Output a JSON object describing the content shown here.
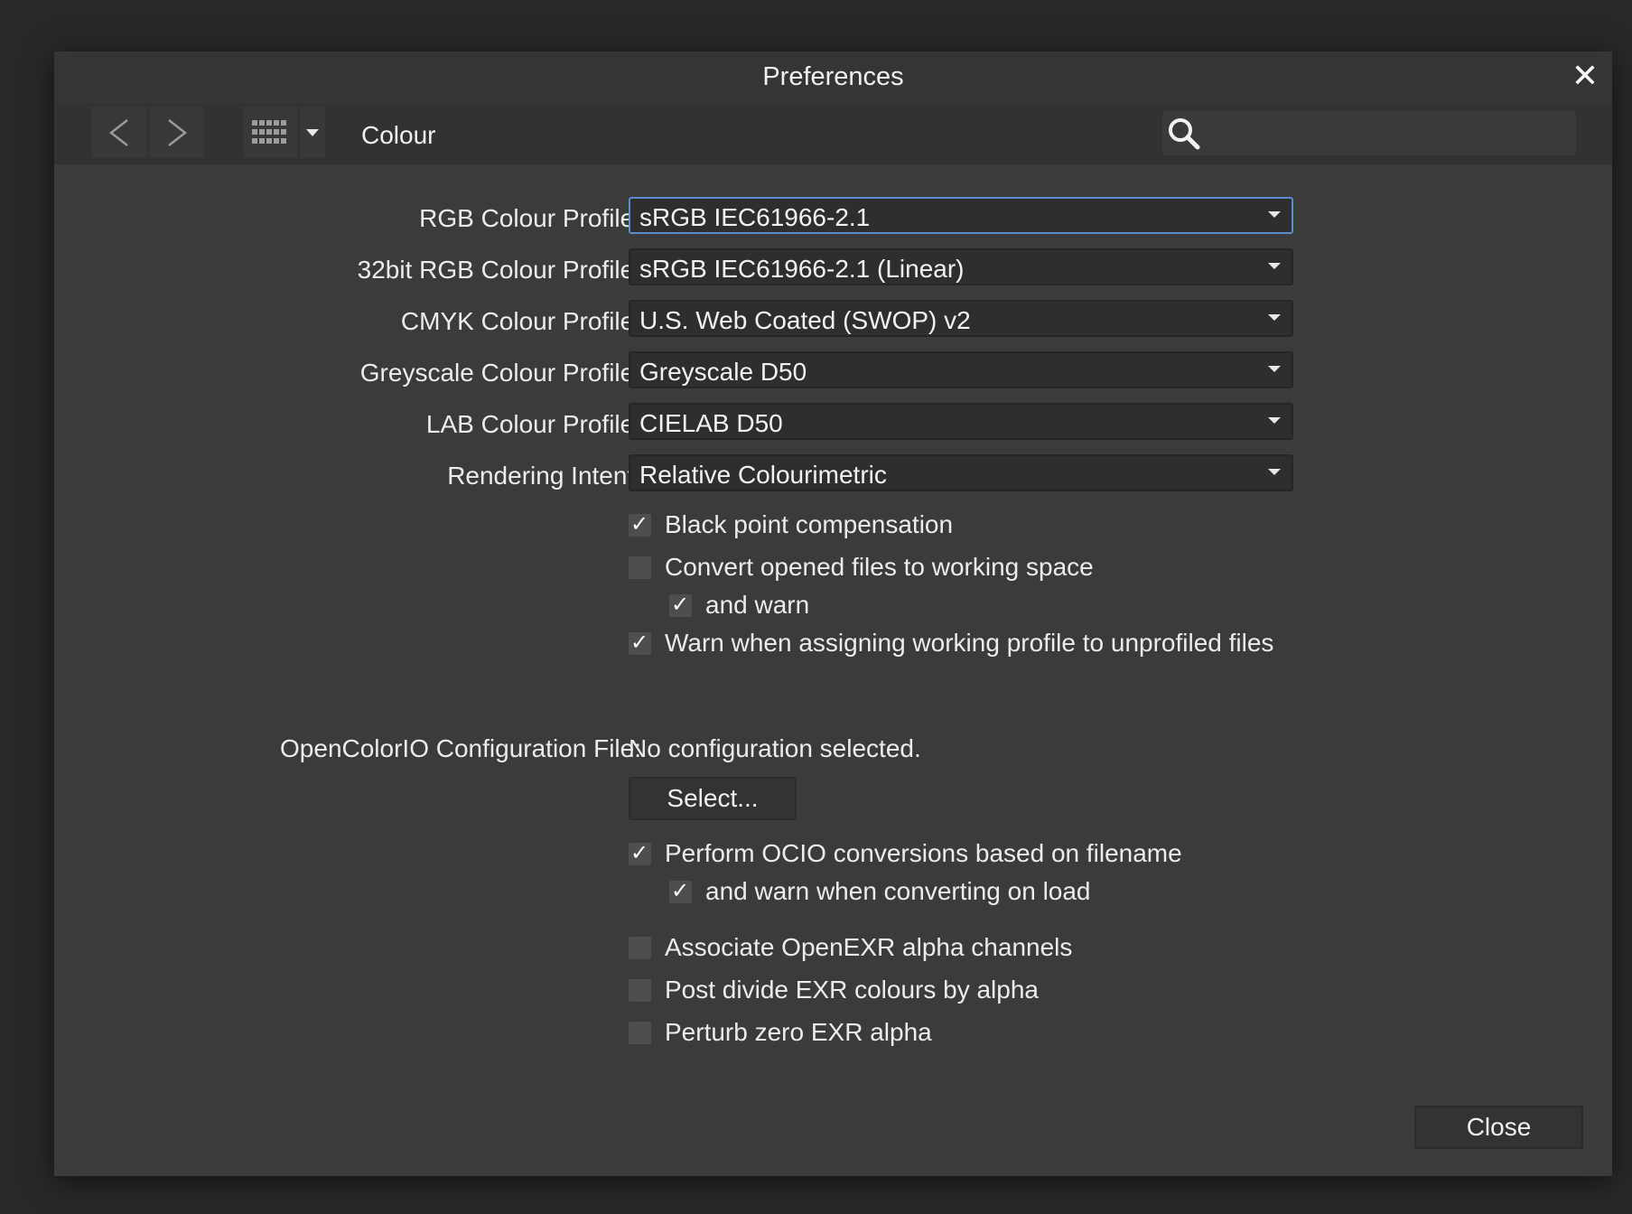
{
  "window": {
    "title": "Preferences"
  },
  "toolbar": {
    "breadcrumb": "Colour",
    "search_placeholder": ""
  },
  "colour_settings": {
    "rows": [
      {
        "label": "RGB Colour Profile:",
        "value": "sRGB IEC61966-2.1"
      },
      {
        "label": "32bit RGB Colour Profile:",
        "value": "sRGB IEC61966-2.1 (Linear)"
      },
      {
        "label": "CMYK Colour Profile:",
        "value": "U.S. Web Coated (SWOP) v2"
      },
      {
        "label": "Greyscale Colour Profile:",
        "value": "Greyscale D50"
      },
      {
        "label": "LAB Colour Profile:",
        "value": "CIELAB D50"
      },
      {
        "label": "Rendering Intent:",
        "value": "Relative Colourimetric"
      }
    ],
    "checkboxes": [
      {
        "label": "Black point compensation",
        "checked": true
      },
      {
        "label": "Convert opened files to working space",
        "checked": false
      },
      {
        "label": "and warn",
        "checked": true
      },
      {
        "label": "Warn when assigning working profile to unprofiled files",
        "checked": true
      }
    ]
  },
  "ocio": {
    "label": "OpenColorIO Configuration File:",
    "value": "No configuration selected.",
    "select_button": "Select...",
    "checkboxes": [
      {
        "label": "Perform OCIO conversions based on filename",
        "checked": true
      },
      {
        "label": "and warn when converting on load",
        "checked": true
      },
      {
        "label": "Associate OpenEXR alpha channels",
        "checked": false
      },
      {
        "label": "Post divide EXR colours by alpha",
        "checked": false
      },
      {
        "label": "Perturb zero EXR alpha",
        "checked": false
      }
    ]
  },
  "footer": {
    "close_button": "Close"
  },
  "colors": {
    "accent_focus": "#5b8bd1",
    "dialog_bg": "#3b3b3b"
  }
}
